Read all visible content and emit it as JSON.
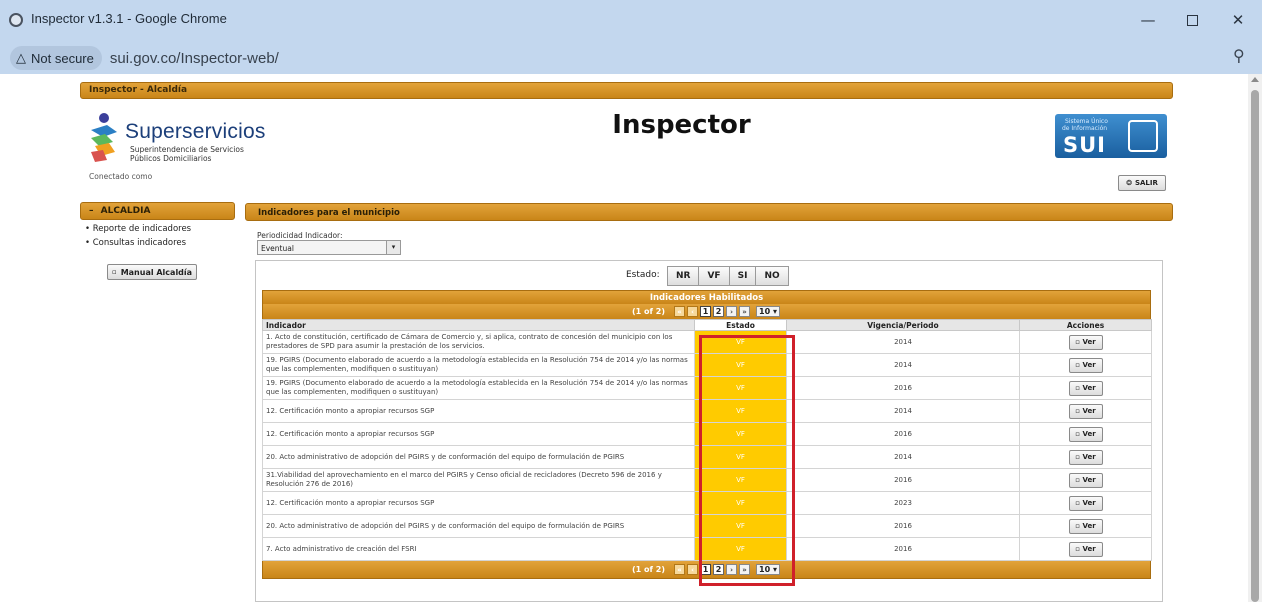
{
  "browser": {
    "window_title": "Inspector v1.3.1 - Google Chrome",
    "security_label": "Not secure",
    "url": "sui.gov.co/Inspector-web/",
    "window_controls": [
      "minimize-icon",
      "maximize-icon",
      "close-icon"
    ]
  },
  "app": {
    "topbar_title": "Inspector - Alcaldía",
    "logo": {
      "brand": "Superservicios",
      "line1": "Superintendencia de Servicios",
      "line2": "Públicos Domiciliarios"
    },
    "connected_label": "Conectado como",
    "page_title": "Inspector",
    "sui_badge": {
      "line1": "Sistema Único",
      "line2": "de Información",
      "abbr": "SUI"
    },
    "logout_label": "SALIR"
  },
  "sidebar": {
    "header": "ALCALDIA",
    "items": [
      "Reporte de indicadores",
      "Consultas indicadores"
    ],
    "manual_button": "Manual Alcaldía"
  },
  "main": {
    "section_title": "Indicadores para el municipio",
    "periodicity_label": "Periodicidad Indicador:",
    "periodicity_value": "Eventual",
    "estado_label": "Estado:",
    "estado_buttons": [
      "NR",
      "VF",
      "SI",
      "NO"
    ]
  },
  "grid": {
    "title": "Indicadores Habilitados",
    "page_counter": "(1 of 2)",
    "pages": [
      "1",
      "2"
    ],
    "rows_per_page": "10",
    "columns": [
      "Indicador",
      "Estado",
      "Vigencia/Periodo",
      "Acciones"
    ],
    "action_label": "Ver",
    "rows": [
      {
        "indicador": "1. Acto de constitución, certificado de Cámara de Comercio y, si aplica, contrato de concesión del municipio con los prestadores de SPD para asumir la prestación de los servicios.",
        "estado": "VF",
        "vigencia": "2014"
      },
      {
        "indicador": "19. PGIRS (Documento elaborado de acuerdo a la metodología establecida en la Resolución 754 de 2014 y/o las normas que las complementen, modifiquen o sustituyan)",
        "estado": "VF",
        "vigencia": "2014"
      },
      {
        "indicador": "19. PGIRS (Documento elaborado de acuerdo a la metodología establecida en la Resolución 754 de 2014 y/o las normas que las complementen, modifiquen o sustituyan)",
        "estado": "VF",
        "vigencia": "2016"
      },
      {
        "indicador": "12. Certificación monto a apropiar recursos SGP",
        "estado": "VF",
        "vigencia": "2014"
      },
      {
        "indicador": "12. Certificación monto a apropiar recursos SGP",
        "estado": "VF",
        "vigencia": "2016"
      },
      {
        "indicador": "20. Acto administrativo de adopción del PGIRS y de conformación del equipo de formulación de PGIRS",
        "estado": "VF",
        "vigencia": "2014"
      },
      {
        "indicador": "31.Viabilidad del aprovechamiento en el marco del PGIRS y Censo oficial de recicladores (Decreto 596 de 2016 y Resolución 276 de 2016)",
        "estado": "VF",
        "vigencia": "2016"
      },
      {
        "indicador": "12. Certificación monto a apropiar recursos SGP",
        "estado": "VF",
        "vigencia": "2023"
      },
      {
        "indicador": "20. Acto administrativo de adopción del PGIRS y de conformación del equipo de formulación de PGIRS",
        "estado": "VF",
        "vigencia": "2016"
      },
      {
        "indicador": "7. Acto administrativo de creación del FSRI",
        "estado": "VF",
        "vigencia": "2016"
      }
    ]
  },
  "colors": {
    "accent_orange": "#d69426",
    "estado_highlight": "#ffcb00",
    "annotation_red": "#d0202a",
    "chrome_frame": "#c3d7ee"
  }
}
